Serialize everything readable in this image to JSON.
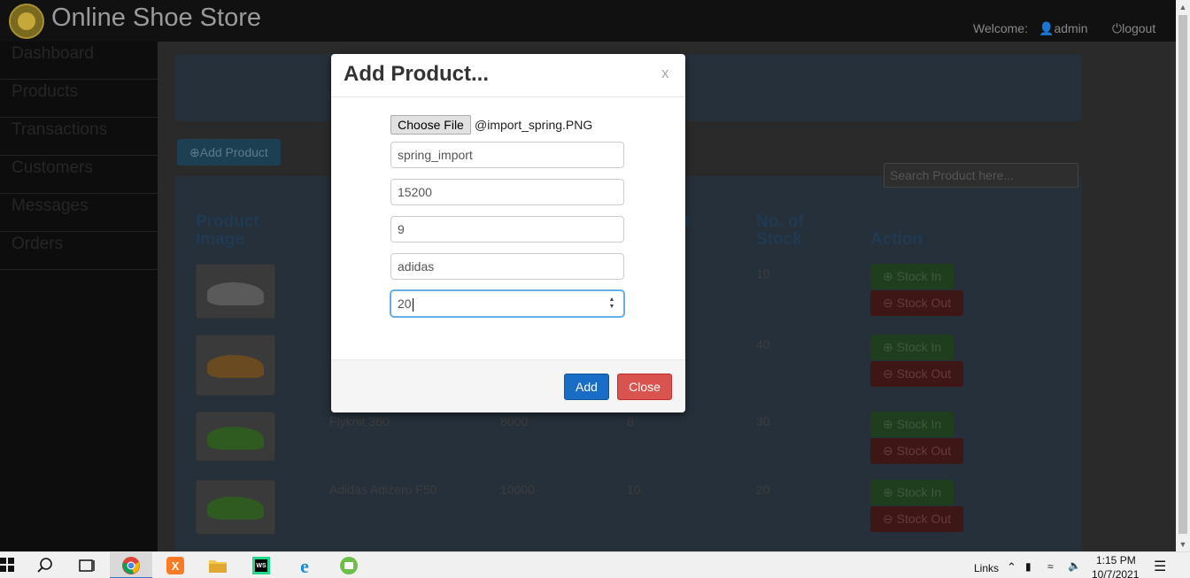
{
  "navbar": {
    "title": "Online Shoe Store",
    "welcome": "Welcome:",
    "user": "admin",
    "logout": "logout"
  },
  "sidebar": {
    "items": [
      {
        "label": "Dashboard"
      },
      {
        "label": "Products"
      },
      {
        "label": "Transactions"
      },
      {
        "label": "Customers"
      },
      {
        "label": "Messages"
      },
      {
        "label": "Orders"
      }
    ]
  },
  "toolbar": {
    "add_product_label": "Add Product",
    "search_placeholder": "Search Product here..."
  },
  "table": {
    "headers": {
      "image": "Product Image",
      "stock": "No. of Stock",
      "action": "Action",
      "partial": "t"
    },
    "rows": [
      {
        "name": "",
        "price": "",
        "size": "",
        "stock": "10"
      },
      {
        "name": "",
        "price": "",
        "size": "",
        "stock": "40"
      },
      {
        "name": "Flyknit 360",
        "price": "8000",
        "size": "8",
        "stock": "30"
      },
      {
        "name": "Adidas Adizero F50",
        "price": "10000",
        "size": "10",
        "stock": "20"
      }
    ],
    "stock_in_label": "Stock In",
    "stock_out_label": "Stock Out"
  },
  "modal": {
    "title": "Add Product...",
    "close_x": "x",
    "choose_file_label": "Choose File",
    "file_name": "@import_spring.PNG",
    "fields": {
      "name": "spring_import",
      "price": "15200",
      "size": "9",
      "brand": "adidas",
      "quantity": "20"
    },
    "add_label": "Add",
    "close_label": "Close"
  },
  "taskbar": {
    "links_label": "Links",
    "time": "1:15 PM",
    "date": "10/7/2021"
  }
}
